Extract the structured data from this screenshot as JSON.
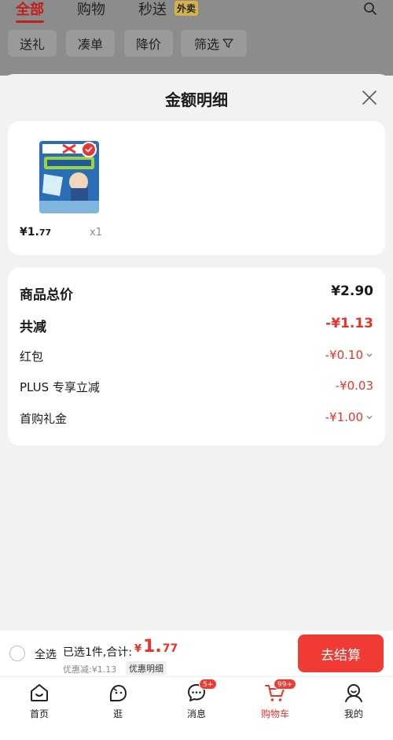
{
  "top_tabs": [
    {
      "label": "全部"
    },
    {
      "label": "购物"
    },
    {
      "label": "秒送"
    }
  ],
  "waimai_badge": "外卖",
  "filter_chips": [
    {
      "label": "送礼"
    },
    {
      "label": "凑单"
    },
    {
      "label": "降价"
    },
    {
      "label": "筛选"
    }
  ],
  "sheet": {
    "title": "金额明细",
    "product": {
      "price_int": "¥1.",
      "price_dec": "77",
      "qty": "x1"
    },
    "rows": [
      {
        "label": "商品总价",
        "value": "¥2.90"
      },
      {
        "label": "共减",
        "value": "-¥1.13"
      },
      {
        "label": "红包",
        "value": "-¥0.10"
      },
      {
        "label": "PLUS 专享立减",
        "value": "-¥0.03"
      },
      {
        "label": "首购礼金",
        "value": "-¥1.00"
      }
    ]
  },
  "settle": {
    "select_all": "全选",
    "summary": "已选1件,合计:",
    "total_sym": "¥",
    "total_int": "1.",
    "total_dec": "77",
    "discount": "优惠减:¥1.13",
    "detail_link": "优惠明细",
    "checkout": "去结算"
  },
  "tabbar": [
    {
      "label": "首页",
      "icon": "home-icon"
    },
    {
      "label": "逛",
      "icon": "face-icon"
    },
    {
      "label": "消息",
      "icon": "message-icon",
      "badge": "5+"
    },
    {
      "label": "购物车",
      "icon": "cart-icon",
      "badge": "99+"
    },
    {
      "label": "我的",
      "icon": "profile-icon"
    }
  ],
  "colors": {
    "accent_red": "#e8332a",
    "tab_red": "#c0201a",
    "checkout_red": "#ef3b34"
  }
}
